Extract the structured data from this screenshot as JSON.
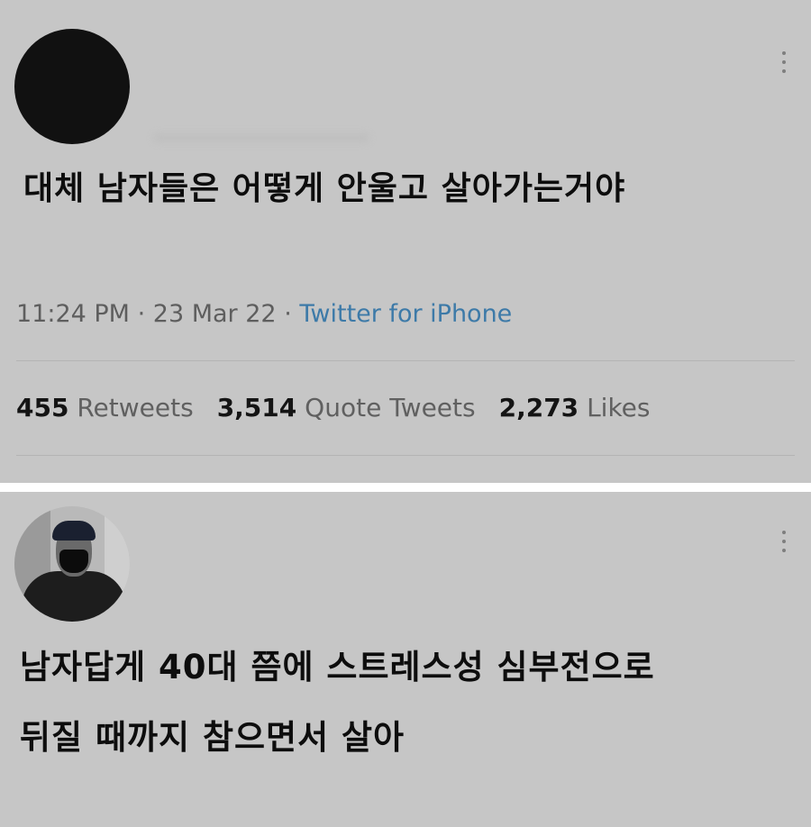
{
  "tweet1": {
    "text": "대체 남자들은 어떻게 안울고 살아가는거야",
    "time": "11:24 PM",
    "separator": "·",
    "date": "23 Mar 22",
    "source": "Twitter for iPhone",
    "stats": {
      "retweets_count": "455",
      "retweets_label": "Retweets",
      "quotes_count": "3,514",
      "quotes_label": "Quote Tweets",
      "likes_count": "2,273",
      "likes_label": "Likes"
    },
    "more_icon": "more-vertical-icon"
  },
  "tweet2": {
    "text_line1": "남자답게 40대 쯤에 스트레스성 심부전으로",
    "text_line2": "뒤질 때까지 참으면서 살아",
    "more_icon": "more-vertical-icon"
  },
  "colors": {
    "card_background": "#c6c6c6",
    "text": "#0d0d0d",
    "meta": "#5e5e5e",
    "link": "#3d7aa8"
  }
}
